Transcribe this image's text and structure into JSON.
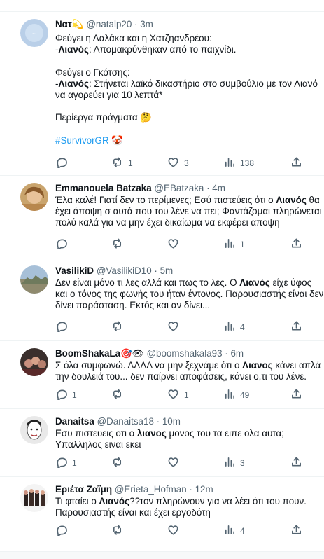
{
  "tweets": [
    {
      "name": "Νατ",
      "name_emoji": "💫",
      "handle": "@natalp20",
      "time": "3m",
      "body": [
        {
          "t": "Φεύγει η Δαλάκα και η Χατζηανδρέου:\n-"
        },
        {
          "t": "Λιανός",
          "b": true
        },
        {
          "t": ": Απομακρύνθηκαν από το παιχνίδι.\n\nΦεύγει ο Γκότσης:\n-"
        },
        {
          "t": "Λιανός",
          "b": true
        },
        {
          "t": ": Στήνεται λαϊκό δικαστήριο στο συμβούλιο με τον Λιανό να αγορεύει για 10 λεπτά*\n\nΠερίεργα πράγματα 🤔\n\n"
        },
        {
          "t": "#SurvivorGR",
          "h": true
        },
        {
          "t": " 🤡"
        }
      ],
      "replies": "",
      "retweets": "1",
      "likes": "3",
      "views": "138"
    },
    {
      "name": "Emmanouela Batzaka",
      "name_emoji": "",
      "handle": "@EBatzaka",
      "time": "4m",
      "body": [
        {
          "t": "Έλα καλέ! Γιατί δεν το περίμενες; Εσύ πιστεύεις ότι ο "
        },
        {
          "t": "Λιανός",
          "b": true
        },
        {
          "t": " θα έχει άποψη σ αυτά που του λένε να πει; Φαντάζομαι πληρώνεται πολύ καλά για να μην έχει δικαίωμα να εκφέρει αποψη"
        }
      ],
      "replies": "",
      "retweets": "",
      "likes": "",
      "views": "1"
    },
    {
      "name": "VasilikiD",
      "name_emoji": "",
      "handle": "@VasilikiD10",
      "time": "5m",
      "body": [
        {
          "t": "Δεν είναι μόνο τι λες αλλά και πως το λες. Ο "
        },
        {
          "t": "Λιανός",
          "b": true
        },
        {
          "t": " είχε ύφος και ο τόνος της φωνής του ήταν έντονος. Παρουσιαστής είναι δεν δίνει παράσταση. Εκτός και αν δίνει..."
        }
      ],
      "replies": "",
      "retweets": "",
      "likes": "",
      "views": "4"
    },
    {
      "name": "BoomShakaLa",
      "name_emoji": "🎯👁",
      "handle": "@boomshakala93",
      "time": "6m",
      "body": [
        {
          "t": "Σ όλα συμφωνώ. ΑΛΛΑ να μην ξεχνάμε ότι ο "
        },
        {
          "t": "Λιανος",
          "b": true
        },
        {
          "t": " κάνει απλά την δουλειά του... δεν παίρνει αποφάσεις, κάνει ο,τι του λένε."
        }
      ],
      "replies": "1",
      "retweets": "",
      "likes": "1",
      "views": "49"
    },
    {
      "name": "Danaitsa",
      "name_emoji": "",
      "handle": "@Danaitsa18",
      "time": "10m",
      "body": [
        {
          "t": "Εσυ πιστευεις οτι ο "
        },
        {
          "t": "λιανος",
          "b": true
        },
        {
          "t": " μονος του τα ειπε ολα αυτα;\nΥπαλληλος ειναι εκει"
        }
      ],
      "replies": "1",
      "retweets": "",
      "likes": "",
      "views": "3"
    },
    {
      "name": "Εριέτα Ζαΐμη",
      "name_emoji": "",
      "handle": "@Erieta_Hofman",
      "time": "12m",
      "body": [
        {
          "t": "Τι φταίει ο "
        },
        {
          "t": "Λιανός",
          "b": true
        },
        {
          "t": "??τον πληρώνουν για να λέει ότι του πουν.\nΠαρουσιαστής είναι και έχει εργοδότη"
        }
      ],
      "replies": "",
      "retweets": "",
      "likes": "",
      "views": "4"
    }
  ],
  "icons": {
    "reply": "reply-icon",
    "retweet": "retweet-icon",
    "like": "heart-icon",
    "views": "views-icon",
    "share": "share-icon"
  },
  "colors": {
    "link": "#1d9bf0",
    "secondary": "#536471",
    "text": "#0f1419",
    "divider": "#eff3f4"
  }
}
